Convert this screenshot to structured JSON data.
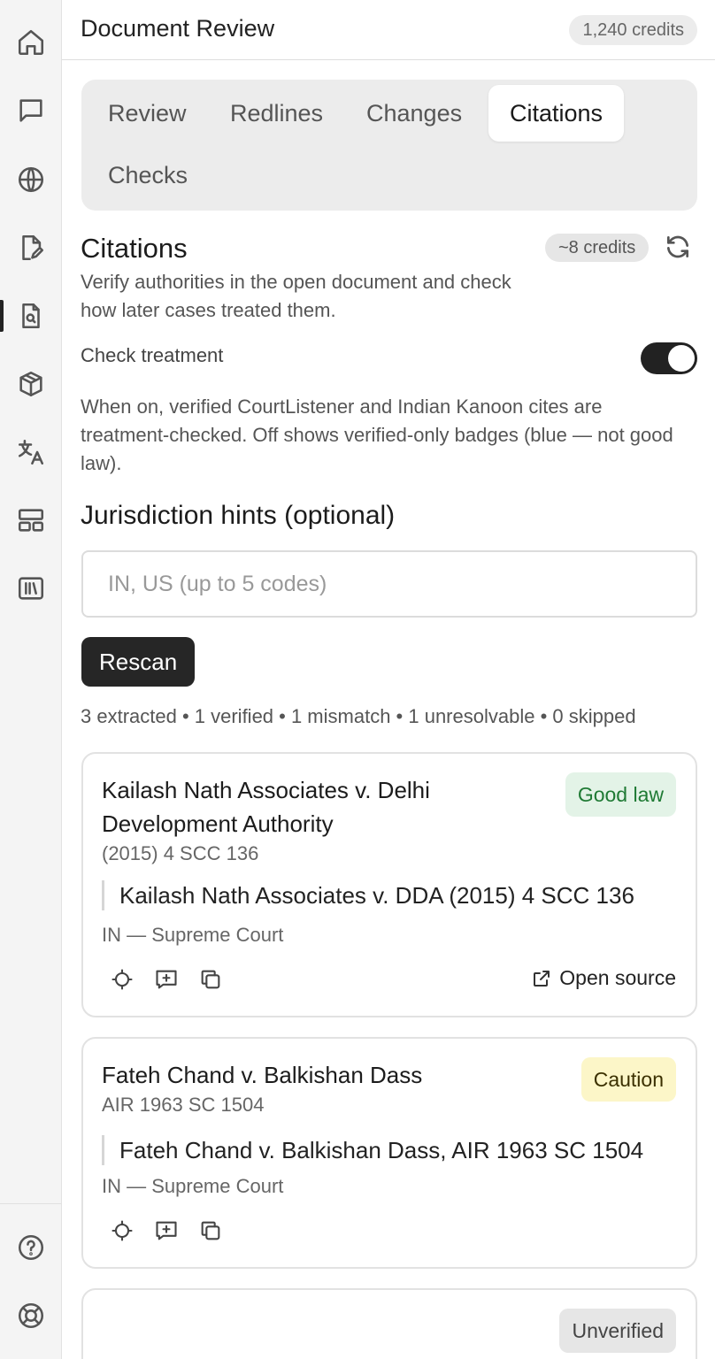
{
  "header": {
    "title": "Document Review",
    "credits": "1,240 credits"
  },
  "sidebar": {
    "top_items": [
      "home",
      "chat",
      "globe",
      "file-edit",
      "file-search",
      "box",
      "translate",
      "layout",
      "library"
    ],
    "bottom_items": [
      "help",
      "support"
    ],
    "active": "file-search"
  },
  "tabs": [
    {
      "label": "Review"
    },
    {
      "label": "Redlines"
    },
    {
      "label": "Changes"
    },
    {
      "label": "Citations",
      "active": true
    },
    {
      "label": "Checks"
    }
  ],
  "citations": {
    "title": "Citations",
    "cost": "~8 credits",
    "description": "Verify authorities in the open document and check how later cases treated them.",
    "toggle_label": "Check treatment",
    "toggle_on": true,
    "toggle_help": "When on, verified CourtListener and Indian Kanoon cites are treatment-checked. Off shows verified-only badges (blue — not good law).",
    "jurisdiction_title": "Jurisdiction hints (optional)",
    "jurisdiction_placeholder": "IN, US (up to 5 codes)",
    "jurisdiction_value": "",
    "rescan_label": "Rescan",
    "summary": "3 extracted • 1 verified • 1 mismatch • 1 unresolvable • 0 skipped"
  },
  "cards": [
    {
      "case_name": "Kailash Nath Associates v. Delhi Development Authority",
      "citation": "(2015) 4 SCC 136",
      "quote": "Kailash Nath Associates v. DDA (2015) 4 SCC 136",
      "court": "IN — Supreme Court",
      "badge": "Good law",
      "open_source": "Open source"
    },
    {
      "case_name": "Fateh Chand v. Balkishan Dass",
      "citation": "AIR 1963 SC 1504",
      "quote": "Fateh Chand v. Balkishan Dass, AIR 1963 SC 1504",
      "court": "IN — Supreme Court",
      "badge": "Caution"
    },
    {
      "badge": "Unverified"
    }
  ],
  "colors": {
    "good_law_bg": "#e3f3e7",
    "good_law_text": "#1f7a34",
    "caution_bg": "#fcf6c8",
    "unverified_bg": "#e6e6e6",
    "primary_button": "#262626"
  }
}
